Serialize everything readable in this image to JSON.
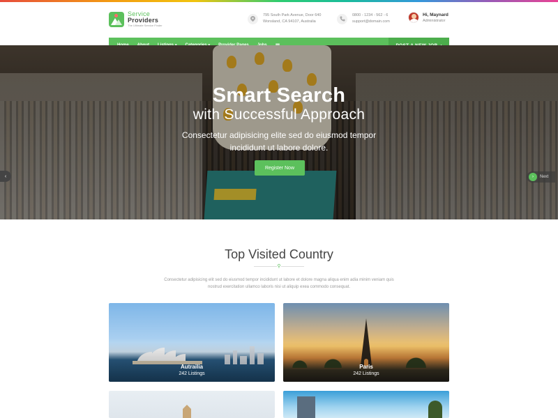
{
  "brand": {
    "name_line1": "Service",
    "name_line2": "Providers",
    "tagline": "The Ultimate Service Finder"
  },
  "header": {
    "address_line1": "795 South Park Avenue, Door 640",
    "address_line2": "Wonsland, CA 94107, Australia",
    "phone": "0800 - 1234 - 562 - 6",
    "email": "support@domain.com",
    "user_greeting": "Hi, Maynard",
    "user_role": "Administrator"
  },
  "nav": {
    "items": [
      {
        "label": "Home",
        "dropdown": false
      },
      {
        "label": "About",
        "dropdown": false
      },
      {
        "label": "Listings",
        "dropdown": true
      },
      {
        "label": "Categories",
        "dropdown": true
      },
      {
        "label": "Provider Pages",
        "dropdown": false
      },
      {
        "label": "Jobs",
        "dropdown": false
      }
    ],
    "menu_icon": "grid-icon",
    "post_job_label": "POST A NEW JOB",
    "post_job_chevron": "›"
  },
  "hero": {
    "title": "Smart Search",
    "subtitle": "with Successful Approach",
    "description": "Consectetur adipisicing elite sed do eiusmod tempor incididunt ut labore dolore.",
    "button_label": "Register Now",
    "prev_arrow": "‹",
    "next_label": "Next",
    "next_arrow": "›"
  },
  "section": {
    "title": "Top Visited Country",
    "divider_icon": "map-pin-icon",
    "description": "Consectetur adipisicing elit sed do eiusmod tempor incididunt ut labore et dolore magna aliqua enim adia minim veniam quis nostrud exercitation ullamco laboris nisi ut aliquip exea commodo consequat."
  },
  "cards": [
    {
      "name": "Autrailia",
      "count": "242 Listings"
    },
    {
      "name": "Paris",
      "count": "242 Listings"
    }
  ],
  "colors": {
    "accent": "#5cc05c",
    "text_dark": "#444444",
    "text_muted": "#999999"
  }
}
